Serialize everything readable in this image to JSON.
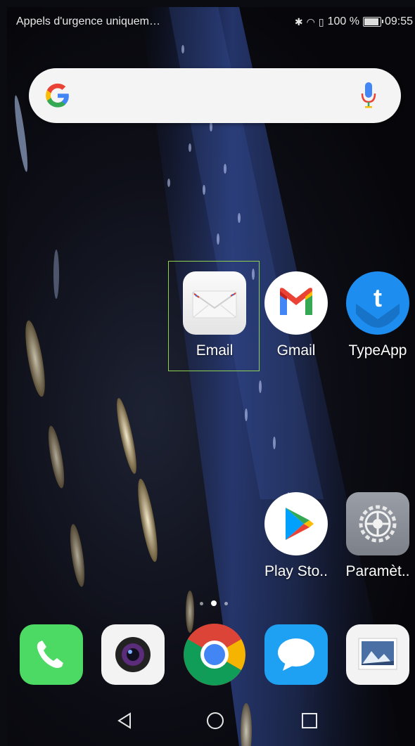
{
  "status": {
    "carrier": "Appels d'urgence uniquem…",
    "battery_percent": "100 %",
    "time": "09:55",
    "icons": [
      "bluetooth-icon",
      "wifi-icon",
      "sim-alert-icon",
      "battery-icon"
    ]
  },
  "search": {
    "logo": "google-g-icon",
    "mic": "mic-icon"
  },
  "apps": [
    {
      "label": "Email",
      "icon": "email-envelope-icon",
      "selected": true
    },
    {
      "label": "Gmail",
      "icon": "gmail-icon"
    },
    {
      "label": "TypeApp",
      "icon": "typeapp-icon"
    },
    {
      "label": "Play Sto..",
      "icon": "play-store-icon"
    },
    {
      "label": "Paramèt..",
      "icon": "settings-gear-icon"
    }
  ],
  "page_indicator": {
    "pages": 3,
    "current": 2
  },
  "dock": [
    {
      "name": "phone",
      "icon": "phone-icon"
    },
    {
      "name": "camera",
      "icon": "camera-icon"
    },
    {
      "name": "chrome",
      "icon": "chrome-icon"
    },
    {
      "name": "messages",
      "icon": "messages-icon"
    },
    {
      "name": "gallery",
      "icon": "gallery-icon"
    }
  ],
  "navbar": {
    "back": "back-triangle-icon",
    "home": "home-circle-icon",
    "recents": "recents-square-icon"
  },
  "colors": {
    "selection_border": "#8fd14f",
    "phone_green": "#4cd964",
    "messages_blue": "#1ea1f2",
    "typeapp_blue": "#1d8ef0"
  }
}
